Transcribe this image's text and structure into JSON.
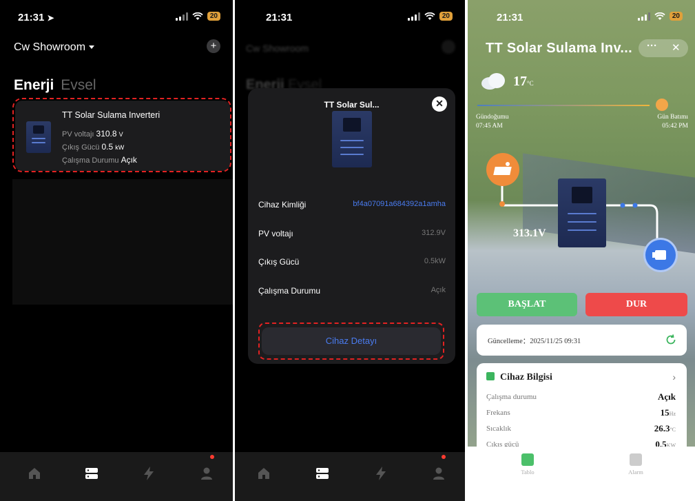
{
  "screen1": {
    "status": {
      "time": "21:31",
      "battery": "20"
    },
    "header": {
      "title": "Cw Showroom",
      "add_icon": "plus-icon"
    },
    "tabs": [
      {
        "label": "Enerji",
        "active": true
      },
      {
        "label": "Evsel",
        "active": false
      }
    ],
    "device": {
      "name": "TT Solar Sulama Inverteri",
      "pv_label": "PV voltajı",
      "pv_value": "310.8",
      "pv_unit": "V",
      "power_label": "Çıkış Gücü",
      "power_value": "0.5",
      "power_unit": "kW",
      "state_label": "Çalışma Durumu",
      "state_value": "Açık"
    },
    "tabbar": [
      "home-icon",
      "devices-icon",
      "energy-icon",
      "profile-icon"
    ]
  },
  "screen2": {
    "status": {
      "time": "21:31",
      "battery": "20"
    },
    "background": {
      "title": "Cw Showroom",
      "tab1": "Enerji",
      "tab2": "Evsel"
    },
    "modal": {
      "title": "TT Solar Sul...",
      "rows": [
        {
          "label": "Cihaz Kimliği",
          "value": "bf4a07091a684392a1amha"
        },
        {
          "label": "PV voltajı",
          "value": "312.9V"
        },
        {
          "label": "Çıkış Gücü",
          "value": "0.5kW"
        },
        {
          "label": "Çalışma Durumu",
          "value": "Açık"
        }
      ],
      "button": "Cihaz Detayı"
    }
  },
  "screen3": {
    "status": {
      "time": "21:31",
      "battery": "20"
    },
    "title": "TT Solar Sulama Inv...",
    "weather": {
      "temp": "17",
      "unit": "°C"
    },
    "sunrise": {
      "label": "Gündoğumu",
      "time": "07:45 AM"
    },
    "sunset": {
      "label": "Gün Batımı",
      "time": "05:42 PM"
    },
    "pv_voltage": "313.1V",
    "buttons": {
      "start": "BAŞLAT",
      "stop": "DUR"
    },
    "update": "Güncelleme：2025/11/25 09:31",
    "info": {
      "title": "Cihaz Bilgisi",
      "rows": [
        {
          "label": "Çalışma durumu",
          "value": "Açık",
          "unit": ""
        },
        {
          "label": "Frekans",
          "value": "15",
          "unit": "Hz"
        },
        {
          "label": "Sıcaklık",
          "value": "26.3",
          "unit": "°C"
        },
        {
          "label": "Çıkış gücü",
          "value": "0.5",
          "unit": "KW"
        }
      ]
    },
    "tabbar": [
      {
        "label": "Tablo"
      },
      {
        "label": "Alarm"
      }
    ],
    "colors": {
      "start": "#5cc177",
      "stop": "#ee4a4a",
      "accent": "#3c78e6",
      "solar": "#f08c3a"
    }
  }
}
